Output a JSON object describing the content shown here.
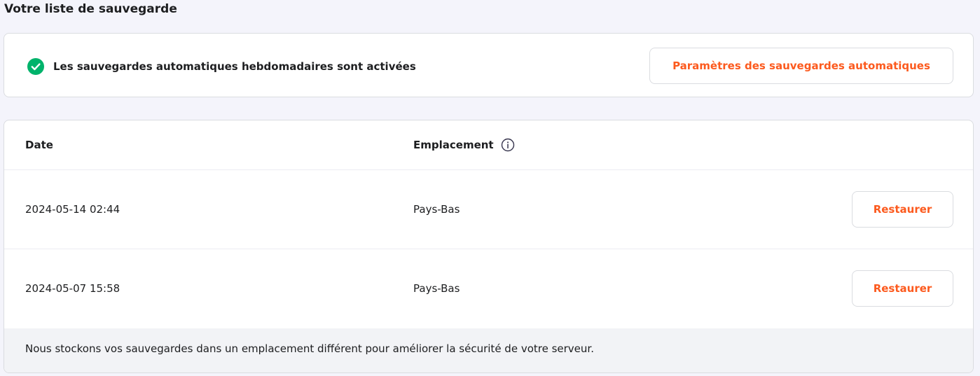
{
  "page": {
    "title": "Votre liste de sauvegarde"
  },
  "status": {
    "icon": "check-circle-icon",
    "icon_color": "#00b36b",
    "text": "Les sauvegardes automatiques hebdomadaires sont activées",
    "settings_button_label": "Paramètres des sauvegardes automatiques"
  },
  "table": {
    "columns": {
      "date": "Date",
      "location": "Emplacement",
      "location_info_icon": "info-icon"
    },
    "rows": [
      {
        "date": "2024-05-14 02:44",
        "location": "Pays-Bas",
        "action_label": "Restaurer"
      },
      {
        "date": "2024-05-07 15:58",
        "location": "Pays-Bas",
        "action_label": "Restaurer"
      }
    ],
    "footer_note": "Nous stockons vos sauvegardes dans un emplacement différent pour améliorer la sécurité de votre serveur."
  },
  "colors": {
    "accent": "#fc5a1e",
    "background": "#f4f4fb",
    "success": "#00b36b"
  }
}
